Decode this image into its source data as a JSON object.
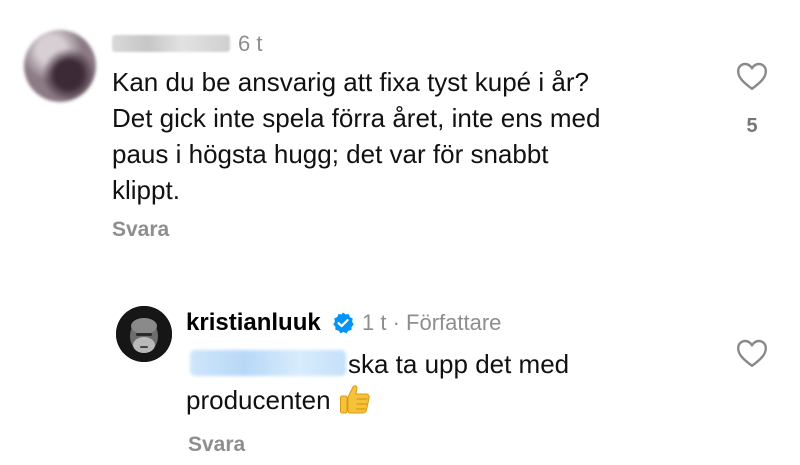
{
  "comment": {
    "time": "6 t",
    "text": "Kan du be ansvarig att fixa tyst kupé i år?\nDet gick inte spela förra året, inte ens med\npaus i högsta hugg; det var för snabbt\nklippt.",
    "reply_label": "Svara",
    "like_count": "5"
  },
  "reply": {
    "author": "kristianluuk",
    "time": "1 t",
    "separator": "·",
    "role": "Författare",
    "text": "ska ta upp det med producenten",
    "emoji": "thumbs-up",
    "reply_label": "Svara"
  },
  "colors": {
    "secondary_text": "#8e8e8e",
    "verified_blue": "#0095f6",
    "thumb_yellow": "#f7c23b"
  }
}
